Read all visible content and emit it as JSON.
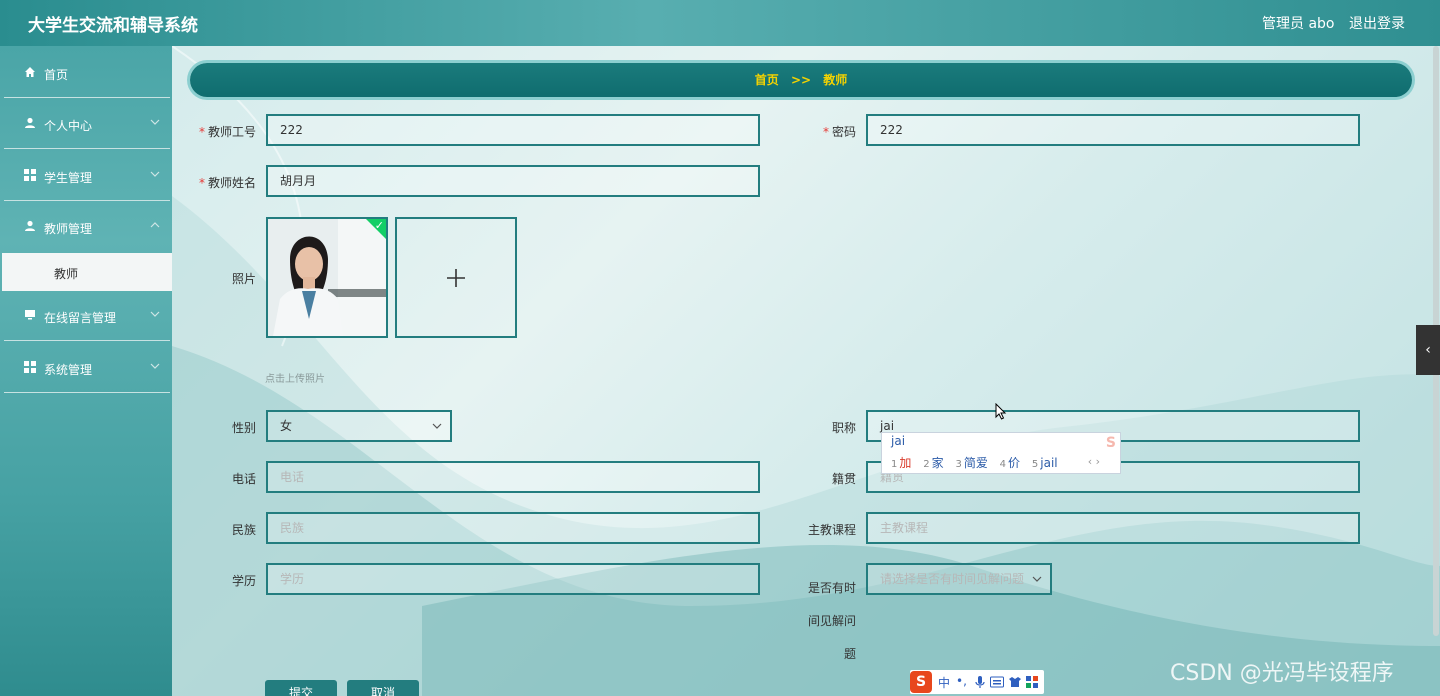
{
  "header": {
    "title": "大学生交流和辅导系统",
    "admin_label": "管理员 abo",
    "logout_label": "退出登录"
  },
  "sidebar": {
    "items": [
      {
        "label": "首页",
        "icon": "home-icon"
      },
      {
        "label": "个人中心",
        "icon": "user-icon"
      },
      {
        "label": "学生管理",
        "icon": "grid-icon"
      },
      {
        "label": "教师管理",
        "icon": "user-icon"
      },
      {
        "label": "在线留言管理",
        "icon": "monitor-icon"
      },
      {
        "label": "系统管理",
        "icon": "grid-icon"
      }
    ],
    "active_sub": "教师"
  },
  "breadcrumb": {
    "home": "首页",
    "sep": ">>",
    "current": "教师"
  },
  "form": {
    "teacher_id": {
      "label": "教师工号",
      "value": "222"
    },
    "password": {
      "label": "密码",
      "value": "222"
    },
    "teacher_name": {
      "label": "教师姓名",
      "value": "胡月月"
    },
    "photo": {
      "label": "照片",
      "hint": "点击上传照片",
      "add_symbol": "+"
    },
    "gender": {
      "label": "性别",
      "value": "女"
    },
    "title": {
      "label": "职称",
      "value": "jai"
    },
    "phone": {
      "label": "电话",
      "placeholder": "电话"
    },
    "native_place": {
      "label": "籍贯",
      "placeholder": "籍贯"
    },
    "ethnicity": {
      "label": "民族",
      "placeholder": "民族"
    },
    "main_course": {
      "label": "主教课程",
      "placeholder": "主教课程"
    },
    "education": {
      "label": "学历",
      "placeholder": "学历"
    },
    "available": {
      "label_lines": [
        "是否有时",
        "间见解问",
        "题"
      ],
      "placeholder": "请选择是否有时间见解问题"
    },
    "submit_label": "提交",
    "cancel_label": "取消"
  },
  "ime": {
    "composition": "jai",
    "candidates": [
      {
        "n": "1",
        "text": "加"
      },
      {
        "n": "2",
        "text": "家"
      },
      {
        "n": "3",
        "text": "简爱"
      },
      {
        "n": "4",
        "text": "价"
      },
      {
        "n": "5",
        "text": "jail"
      }
    ],
    "nav": "‹ ›",
    "toolbar": {
      "logo": "S",
      "mode": "中",
      "punct": "•,"
    }
  },
  "watermark": "CSDN @光冯毕设程序",
  "drawer_symbol": "‹",
  "colors": {
    "accent": "#237d7f",
    "breadcrumb_text": "#f5d300",
    "required": "#e53935"
  }
}
